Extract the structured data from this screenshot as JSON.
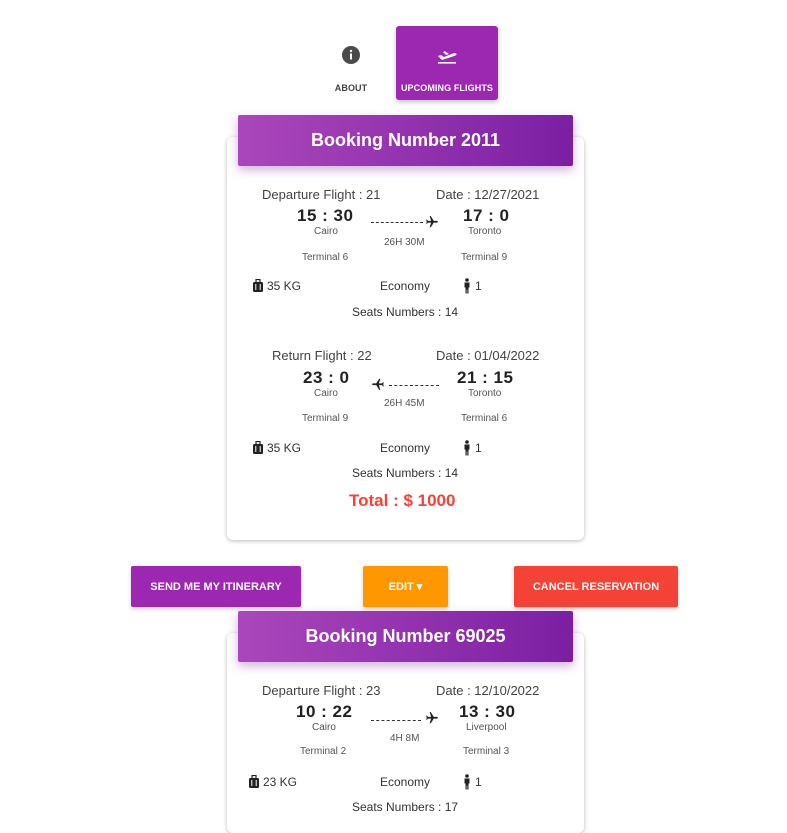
{
  "nav": {
    "about_label": "ABOUT",
    "flights_label": "UPCOMING FLIGHTS",
    "about_icon": "info-icon",
    "flights_icon": "flight-takeoff-icon",
    "accent": "#9c27b0"
  },
  "bookings": [
    {
      "title": "Booking Number 2011",
      "departure": {
        "flight_label": "Departure Flight : 21",
        "date_label": "Date : 12/27/2021",
        "from_time": "15 : 30",
        "from_city": "Cairo",
        "to_time": "17 : 0",
        "to_city": "Toronto",
        "duration": "26H 30M",
        "from_terminal": "Terminal 6",
        "to_terminal": "Terminal 9",
        "baggage": "35 KG",
        "cabin": "Economy",
        "passengers": "1",
        "seats": "Seats Numbers : 14"
      },
      "return": {
        "flight_label": "Return Flight : 22",
        "date_label": "Date : 01/04/2022",
        "from_time": "23 : 0",
        "from_city": "Cairo",
        "to_time": "21 : 15",
        "to_city": "Toronto",
        "duration": "26H 45M",
        "from_terminal": "Terminal 9",
        "to_terminal": "Terminal 6",
        "baggage": "35 KG",
        "cabin": "Economy",
        "passengers": "1",
        "seats": "Seats Numbers : 14"
      },
      "total": "Total : $ 1000"
    },
    {
      "title": "Booking Number 69025",
      "departure": {
        "flight_label": "Departure Flight : 23",
        "date_label": "Date : 12/10/2022",
        "from_time": "10 : 22",
        "from_city": "Cairo",
        "to_time": "13 : 30",
        "to_city": "Liverpool",
        "duration": "4H 8M",
        "from_terminal": "Terminal 2",
        "to_terminal": "Terminal 3",
        "baggage": "23 KG",
        "cabin": "Economy",
        "passengers": "1",
        "seats": "Seats Numbers : 17"
      }
    }
  ],
  "actions": {
    "itinerary_label": "SEND ME MY ITINERARY",
    "edit_label": "EDIT ▾",
    "cancel_label": "CANCEL RESERVATION",
    "itinerary_color": "#9c27b0",
    "edit_color": "#ff9800",
    "cancel_color": "#f44336"
  }
}
